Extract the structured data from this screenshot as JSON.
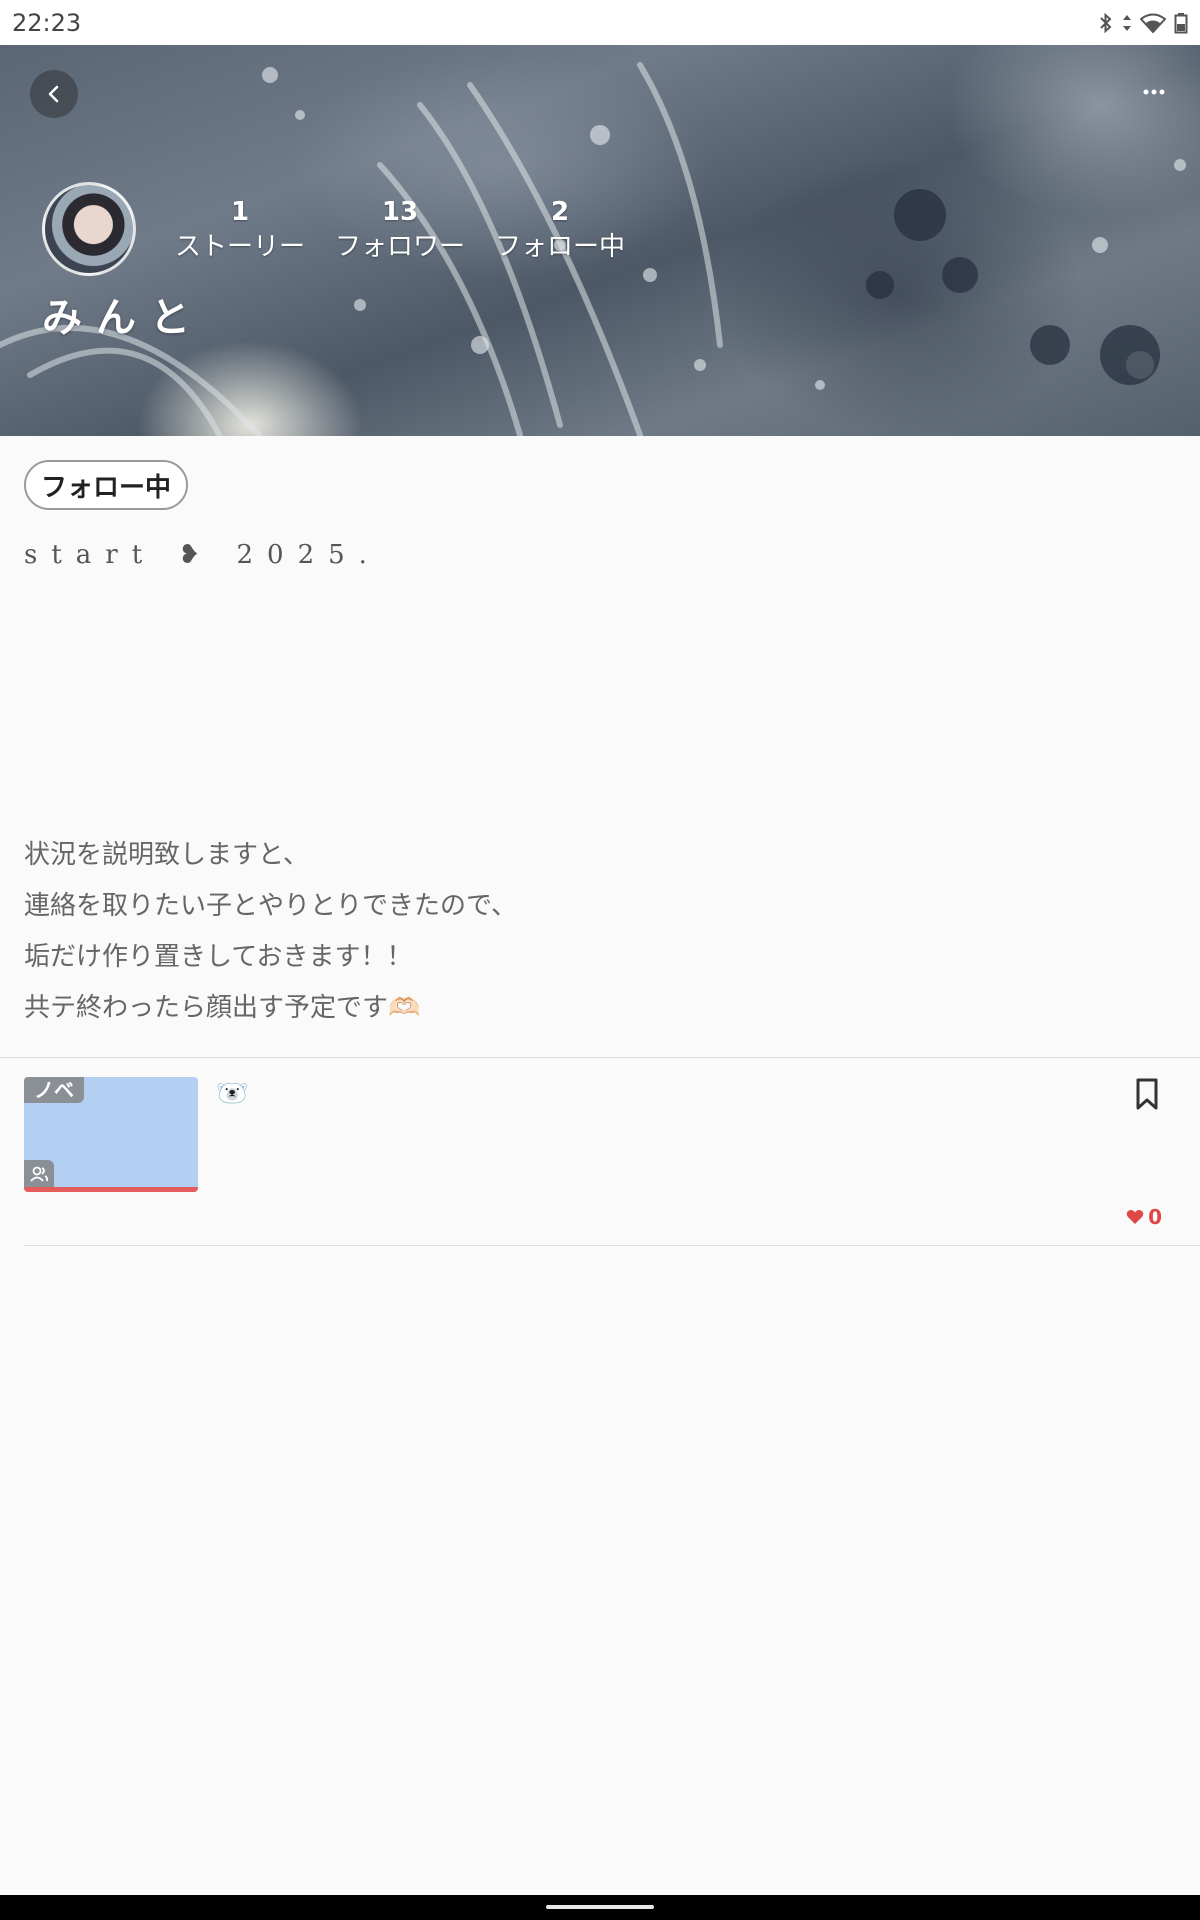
{
  "status_bar": {
    "time": "22:23",
    "icons": [
      "bluetooth-icon",
      "data-arrows-icon",
      "wifi-icon",
      "battery-icon"
    ]
  },
  "header": {
    "back_icon": "chevron-left-icon",
    "more_icon": "more-horizontal-icon",
    "stats": [
      {
        "value": "1",
        "label": "ストーリー"
      },
      {
        "value": "13",
        "label": "フォロワー"
      },
      {
        "value": "2",
        "label": "フォロー中"
      }
    ],
    "username": "みんと"
  },
  "follow_button": {
    "label": "フォロー中"
  },
  "bio": {
    "start_line": "start  ❥  2025.",
    "lines": [
      "状況を説明致しますと、",
      "連絡を取りたい子とやりとりできたので、",
      "垢だけ作り置きしておきます！！",
      "共テ終わったら顔出す予定です🫶🏻"
    ]
  },
  "story_item": {
    "tag": "ノベ",
    "title": "🐻‍❄️",
    "thumbnail_color": "#b3d0f2",
    "likes": "0",
    "like_color": "#e04848"
  }
}
